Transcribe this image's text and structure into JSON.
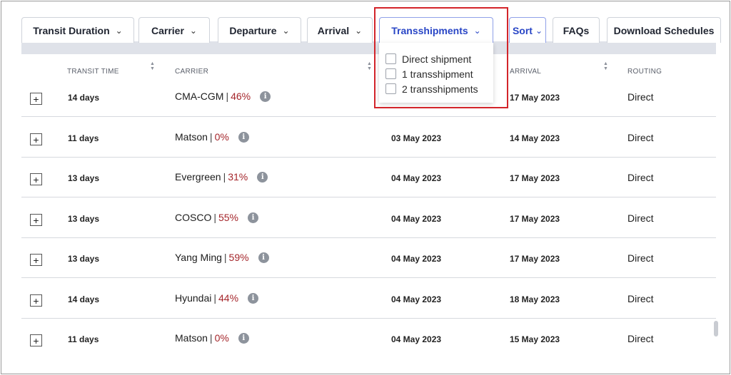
{
  "filters": [
    {
      "label": "Transit Duration",
      "active": false,
      "has_chevron": true
    },
    {
      "label": "Carrier",
      "active": false,
      "has_chevron": true
    },
    {
      "label": "Departure",
      "active": false,
      "has_chevron": true
    },
    {
      "label": "Arrival",
      "active": false,
      "has_chevron": true
    },
    {
      "label": "Transshipments",
      "active": true,
      "has_chevron": true
    },
    {
      "label": "Sort",
      "active": true,
      "has_chevron": true
    },
    {
      "label": "FAQs",
      "active": false,
      "has_chevron": false
    },
    {
      "label": "Download Schedules",
      "active": false,
      "has_chevron": false
    }
  ],
  "transshipments_dropdown": {
    "options": [
      "Direct shipment",
      "1 transshipment",
      "2 transshipments"
    ]
  },
  "table": {
    "headers": {
      "transit_time": "TRANSIT TIME",
      "carrier": "CARRIER",
      "arrival": "ARRIVAL",
      "routing": "ROUTING"
    },
    "rows": [
      {
        "transit": "14 days",
        "carrier": "CMA-CGM",
        "reliability": "46%",
        "departure": "",
        "arrival": "17 May 2023",
        "routing": "Direct"
      },
      {
        "transit": "11 days",
        "carrier": "Matson",
        "reliability": "0%",
        "departure": "03 May 2023",
        "arrival": "14 May 2023",
        "routing": "Direct"
      },
      {
        "transit": "13 days",
        "carrier": "Evergreen",
        "reliability": "31%",
        "departure": "04 May 2023",
        "arrival": "17 May 2023",
        "routing": "Direct"
      },
      {
        "transit": "13 days",
        "carrier": "COSCO",
        "reliability": "55%",
        "departure": "04 May 2023",
        "arrival": "17 May 2023",
        "routing": "Direct"
      },
      {
        "transit": "13 days",
        "carrier": "Yang Ming",
        "reliability": "59%",
        "departure": "04 May 2023",
        "arrival": "17 May 2023",
        "routing": "Direct"
      },
      {
        "transit": "14 days",
        "carrier": "Hyundai",
        "reliability": "44%",
        "departure": "04 May 2023",
        "arrival": "18 May 2023",
        "routing": "Direct"
      },
      {
        "transit": "11 days",
        "carrier": "Matson",
        "reliability": "0%",
        "departure": "04 May 2023",
        "arrival": "15 May 2023",
        "routing": "Direct"
      }
    ]
  },
  "colors": {
    "accent": "#2946c6",
    "reliability": "#a5262b",
    "highlight_box": "#d3242a"
  }
}
